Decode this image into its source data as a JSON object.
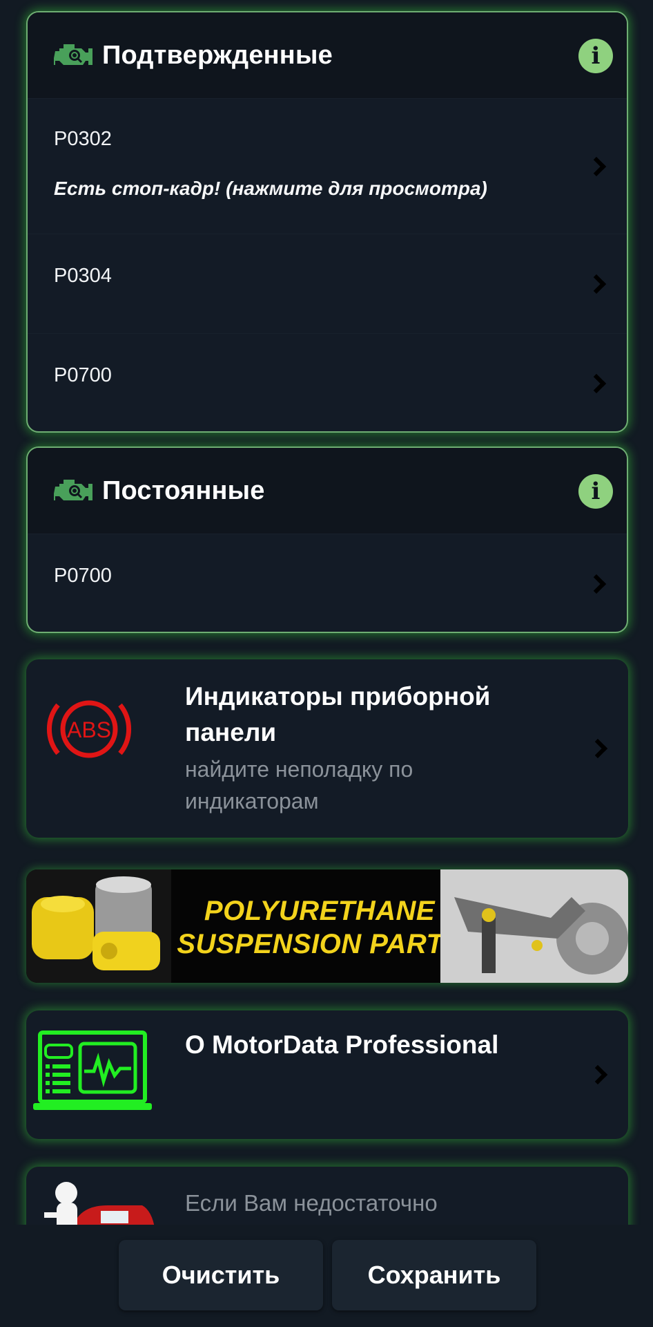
{
  "confirmed": {
    "title": "Подтвержденные",
    "codes": [
      {
        "code": "P0302",
        "note": "Есть стоп-кадр! (нажмите для просмотра)"
      },
      {
        "code": "P0304"
      },
      {
        "code": "P0700"
      }
    ]
  },
  "permanent": {
    "title": "Постоянные",
    "codes": [
      {
        "code": "P0700"
      }
    ]
  },
  "indicators": {
    "title": "Индикаторы приборной панели",
    "subtitle": "найдите неполадку по индикаторам",
    "icon_label": "ABS"
  },
  "ad_banner": {
    "line1": "POLYURETHANE",
    "line2": "SUSPENSION PARTS"
  },
  "about": {
    "title": "О MotorData Professional"
  },
  "help": {
    "text": "Если Вам недостаточно"
  },
  "actions": {
    "clear_label": "Очистить",
    "save_label": "Сохранить"
  },
  "colors": {
    "card_glow": "#3cd23c",
    "info_icon": "#8fd17f",
    "engine_icon": "#49a05a",
    "abs_red": "#e01515",
    "laptop_green": "#22ee22",
    "banner_yellow": "#f3d31c"
  }
}
